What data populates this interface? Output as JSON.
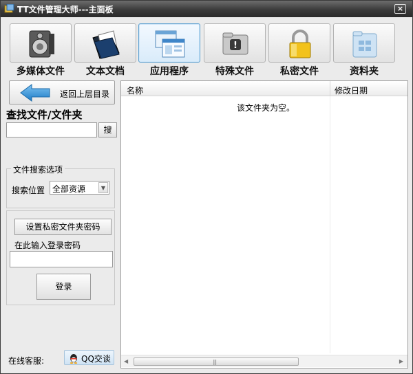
{
  "window": {
    "title": "TT文件管理大师---主面板",
    "close": "×"
  },
  "toolbar": {
    "items": [
      {
        "label": "多媒体文件",
        "icon": "speaker-icon"
      },
      {
        "label": "文本文档",
        "icon": "folder-document-icon"
      },
      {
        "label": "应用程序",
        "icon": "application-window-icon",
        "active": true
      },
      {
        "label": "特殊文件",
        "icon": "special-folder-icon"
      },
      {
        "label": "私密文件",
        "icon": "padlock-icon"
      },
      {
        "label": "资料夹",
        "icon": "data-folder-icon"
      }
    ]
  },
  "sidebar": {
    "back_label": "返回上层目录",
    "find_title": "查找文件/文件夹",
    "search_value": "",
    "search_button": "搜",
    "options_legend": "文件搜索选项",
    "location_label": "搜索位置",
    "location_value": "全部资源",
    "set_password_button": "设置私密文件夹密码",
    "password_hint": "在此输入登录密码",
    "password_value": "",
    "login_button": "登录",
    "service_label": "在线客服:",
    "qq_button": "QQ交谈"
  },
  "filelist": {
    "columns": [
      "名称",
      "修改日期"
    ],
    "empty_message": "该文件夹为空。",
    "rows": []
  },
  "colors": {
    "accent": "#2b8fd6",
    "titlebar": "#3b3b3b",
    "background": "#ebebeb"
  }
}
